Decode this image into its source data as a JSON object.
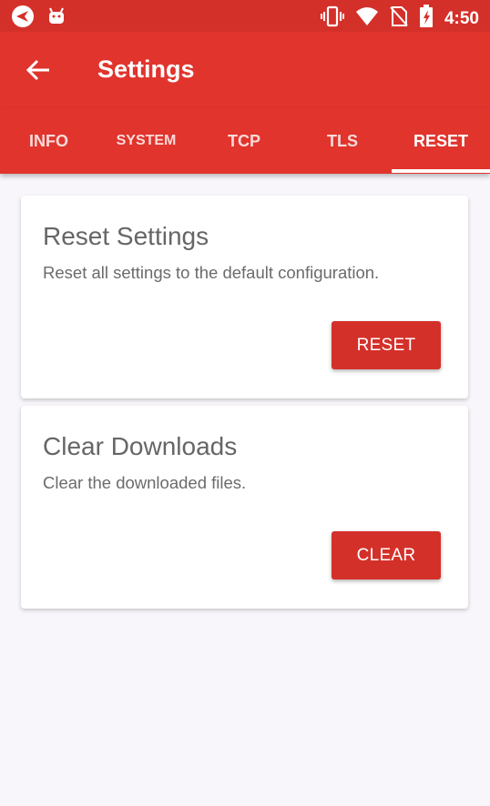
{
  "status_bar": {
    "time": "4:50",
    "icons": [
      "app-notification-icon",
      "android-icon",
      "vibrate-icon",
      "wifi-icon",
      "no-sim-icon",
      "battery-charging-icon"
    ]
  },
  "app_bar": {
    "title": "Settings",
    "back_icon": "arrow-back-icon"
  },
  "tabs": [
    {
      "label": "INFO",
      "active": false
    },
    {
      "label": "SYSTEM",
      "active": false
    },
    {
      "label": "TCP",
      "active": false
    },
    {
      "label": "TLS",
      "active": false
    },
    {
      "label": "RESET",
      "active": true
    }
  ],
  "cards": {
    "reset": {
      "title": "Reset Settings",
      "description": "Reset all settings to the default configuration.",
      "button_label": "RESET"
    },
    "clear": {
      "title": "Clear Downloads",
      "description": "Clear the downloaded files.",
      "button_label": "CLEAR"
    }
  },
  "colors": {
    "primary": "#e0342d",
    "primary_dark": "#d4302a",
    "background": "#f8f6fa"
  }
}
